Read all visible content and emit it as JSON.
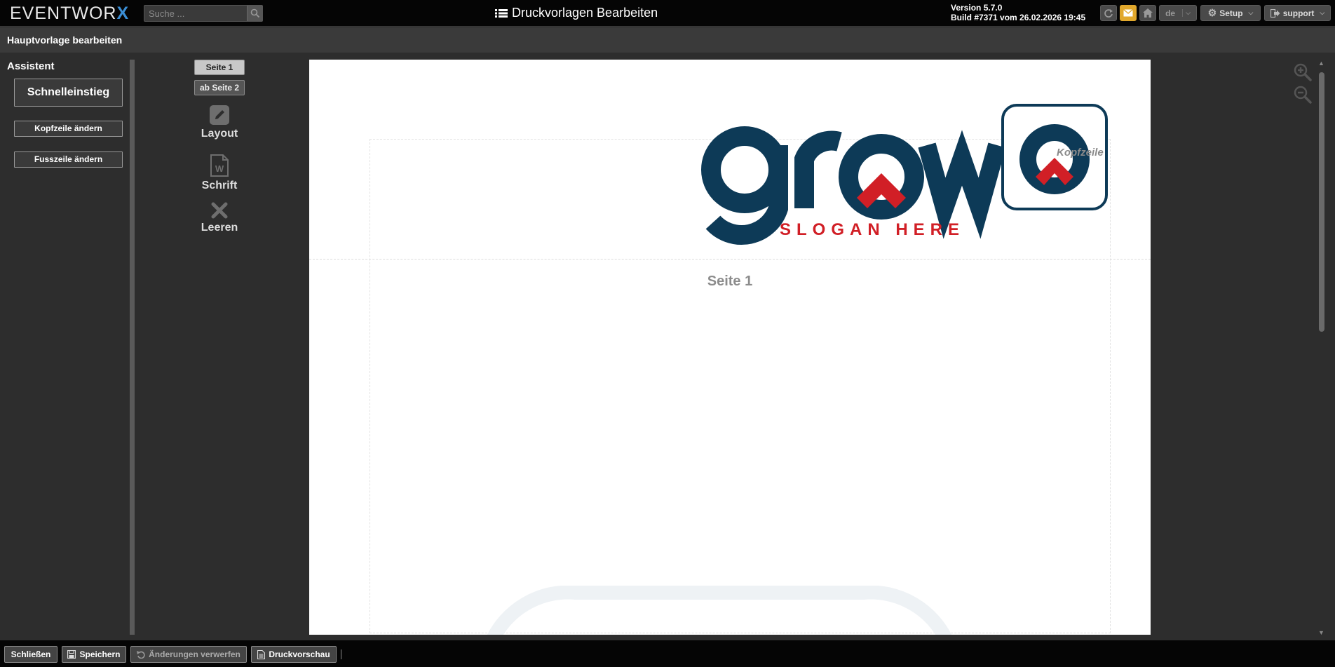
{
  "app": {
    "logo_text": "EVENTWOR",
    "logo_accent": "X",
    "page_title": "Druckvorlagen Bearbeiten",
    "version_line1": "Version 5.7.0",
    "version_line2": "Build #7371 vom 26.02.2026 19:45"
  },
  "search": {
    "placeholder": "Suche ..."
  },
  "toolbar": {
    "lang_label": "de",
    "setup_label": "Setup",
    "user_label": "support",
    "mail_color": "#e1a82c"
  },
  "subheader": {
    "title": "Hauptvorlage bearbeiten"
  },
  "sidebar": {
    "title": "Assistent",
    "quick_label": "Schnelleinstieg",
    "header_label": "Kopfzeile ändern",
    "footer_label": "Fusszeile ändern"
  },
  "tools": {
    "tab_page1": "Seite 1",
    "tab_page2": "ab Seite 2",
    "layout_label": "Layout",
    "font_label": "Schrift",
    "clear_label": "Leeren"
  },
  "document": {
    "header_label": "Kopfzeile",
    "page_label": "Seite 1",
    "logo_word": "grow",
    "logo_slogan": "SLOGAN HERE",
    "brand_blue": "#0d3a57",
    "brand_red": "#d11f26"
  },
  "bottombar": {
    "close_label": "Schließen",
    "save_label": "Speichern",
    "discard_label": "Änderungen verwerfen",
    "preview_label": "Druckvorschau"
  }
}
